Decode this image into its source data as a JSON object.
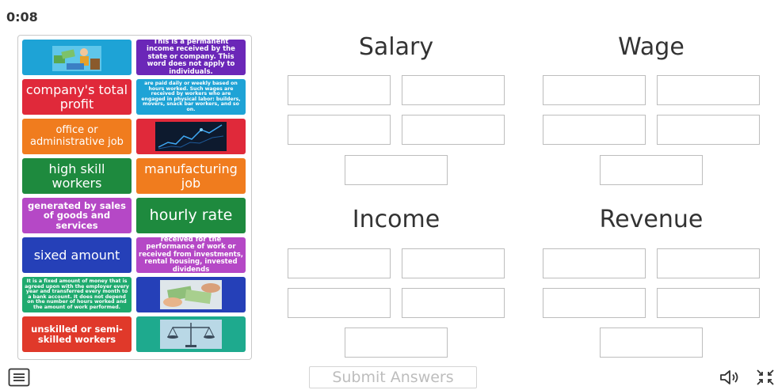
{
  "timer": "0:08",
  "tiles": [
    {
      "text": "",
      "image": "person-with-money-image",
      "color": "#1ea3d6"
    },
    {
      "text": "This is a permanent income received by the state or company. This word does not apply to individuals.",
      "color": "#6b27b8"
    },
    {
      "text": "company's total profit",
      "color": "#e0293a"
    },
    {
      "text": "are paid daily or weekly based on hours worked. Such wages are received by workers who are engaged in physical labor: builders, movers, snack bar workers, and so on.",
      "color": "#1ea3d6"
    },
    {
      "text": "office or administrative job",
      "color": "#f07c1e"
    },
    {
      "text": "",
      "image": "stock-chart-image",
      "color": "#e0293a"
    },
    {
      "text": "high skill workers",
      "color": "#1e8a3e"
    },
    {
      "text": "manufacturing job",
      "color": "#f07c1e"
    },
    {
      "text": "generated by sales of goods and services",
      "color": "#b548c6"
    },
    {
      "text": "hourly rate",
      "color": "#1e8a3e"
    },
    {
      "text": "sixed amount",
      "color": "#2540b8"
    },
    {
      "text": "received for the performance of work or received from investments, rental housing, invested dividends",
      "color": "#b548c6"
    },
    {
      "text": "It is a fixed amount of money that is agreed upon with the employer every year and transferred every month to a bank account. It does not depend on the number of hours worked and the amount of work performed.",
      "color": "#1eaa6e"
    },
    {
      "text": "",
      "image": "cash-handover-image",
      "color": "#2540b8"
    },
    {
      "text": "unskilled or semi-skilled workers",
      "color": "#e0392a"
    },
    {
      "text": "",
      "image": "balance-scale-image",
      "color": "#1eaa8e"
    }
  ],
  "categories": [
    "Salary",
    "Wage",
    "Income",
    "Revenue"
  ],
  "submit_label": "Submit Answers"
}
